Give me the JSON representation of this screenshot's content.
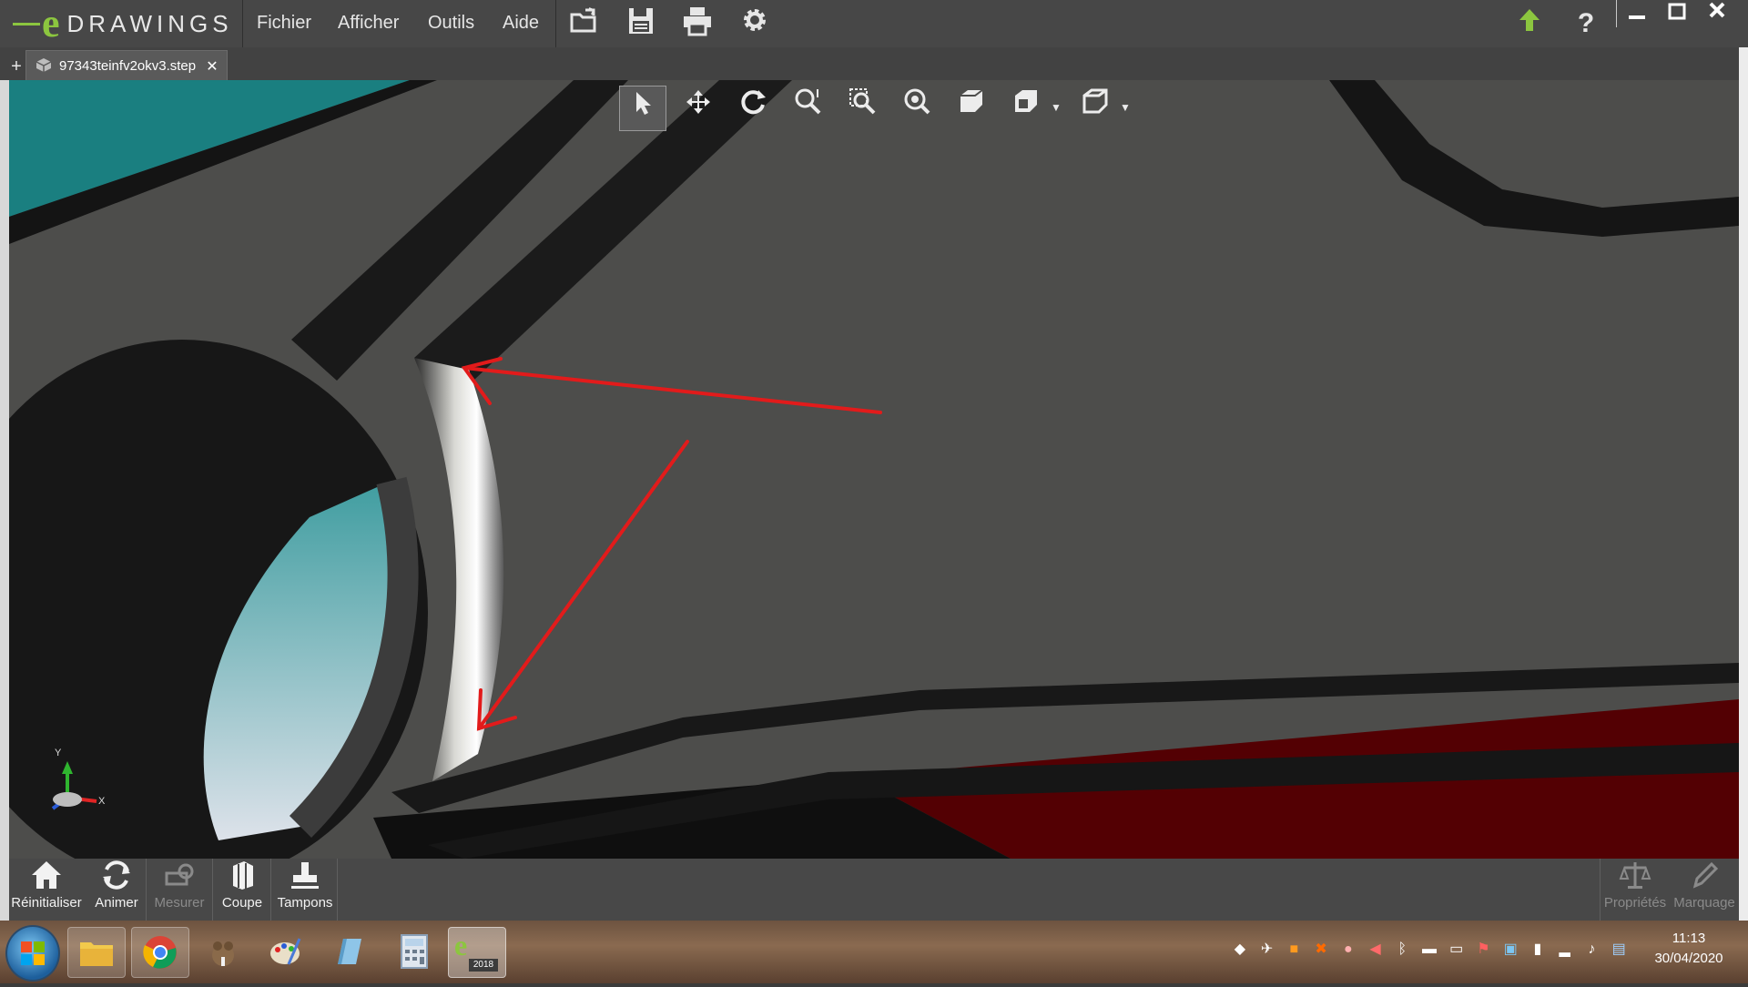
{
  "app": {
    "logo_text": "DRAWINGS",
    "logo_letter": "e"
  },
  "menu": {
    "fichier": "Fichier",
    "afficher": "Afficher",
    "outils": "Outils",
    "aide": "Aide"
  },
  "tab": {
    "filename": "97343teinfv2okv3.step"
  },
  "bottom_toolbar": {
    "reinitialiser": "Réinitialiser",
    "animer": "Animer",
    "mesurer": "Mesurer",
    "coupe": "Coupe",
    "tampons": "Tampons",
    "proprietes": "Propriétés",
    "marquage": "Marquage"
  },
  "triad": {
    "y": "Y",
    "x": "X"
  },
  "taskbar": {
    "edrawings_badge": "2018"
  },
  "clock": {
    "time": "11:13",
    "date": "30/04/2020"
  },
  "colors": {
    "accent_green": "#8cc63f",
    "annotation_red": "#e21b1b",
    "model_gray": "#4d4d4b",
    "face_teal": "#1a7f80",
    "face_red": "#530003"
  },
  "icons": [
    "open-file-icon",
    "save-icon",
    "print-icon",
    "settings-gear-icon",
    "upload-arrow-icon",
    "help-icon",
    "select-pointer-icon",
    "pan-icon",
    "rotate-icon",
    "zoom-to-fit-icon",
    "zoom-area-icon",
    "zoom-in-out-icon",
    "view-cube-icon",
    "display-style-icon",
    "view-orientation-icon",
    "home-icon",
    "animate-icon",
    "measure-icon",
    "section-icon",
    "stamp-icon",
    "properties-scale-icon",
    "markup-pencil-icon"
  ]
}
